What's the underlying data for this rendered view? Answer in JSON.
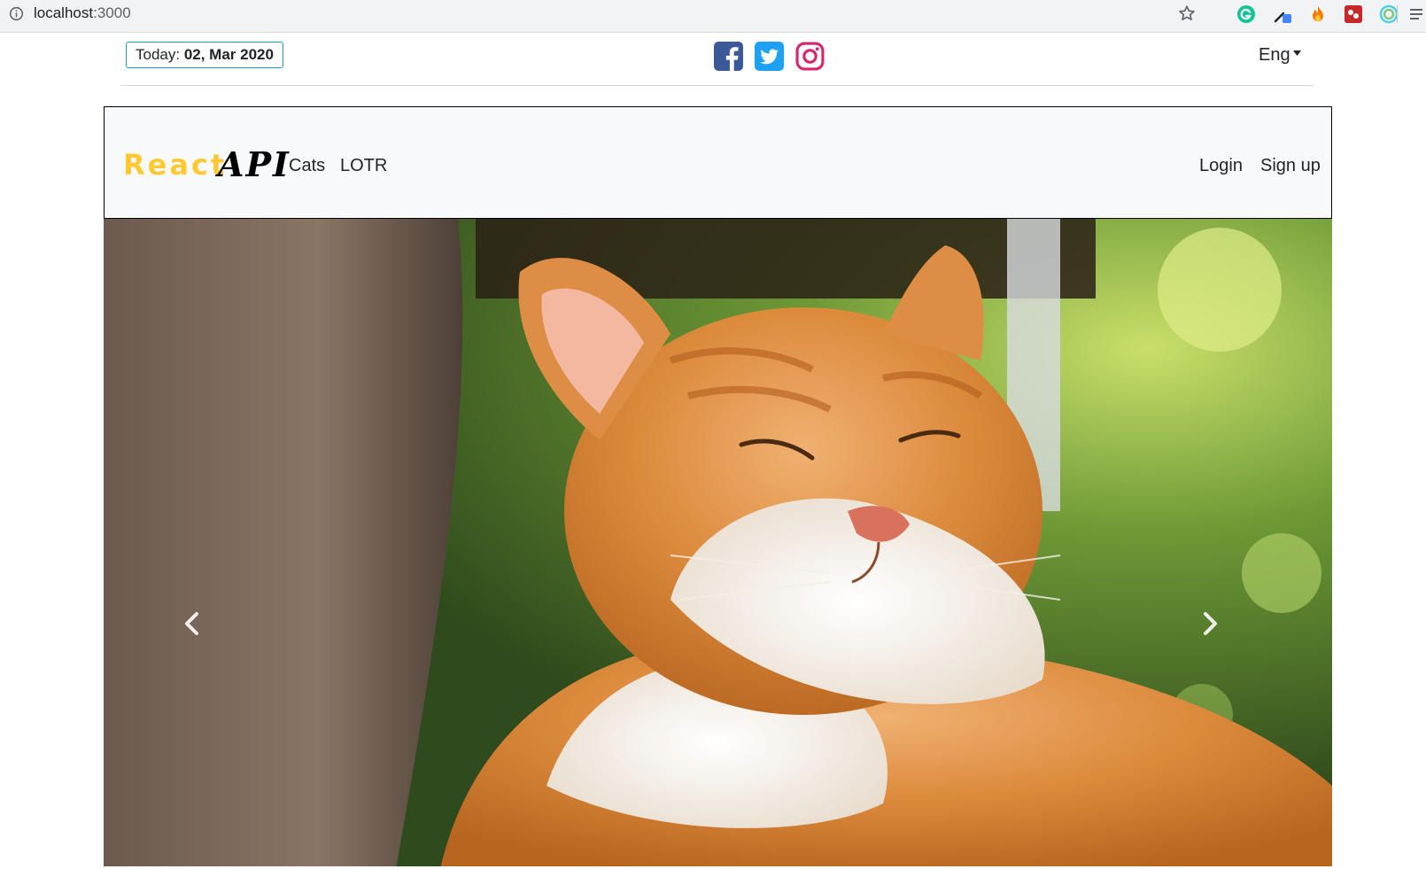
{
  "browser": {
    "url_host": "localhost",
    "url_port": ":3000"
  },
  "topbar": {
    "today_label": "Today:",
    "today_date": "02, Mar 2020",
    "language": "Eng",
    "social_icons": [
      "facebook-icon",
      "twitter-icon",
      "instagram-icon"
    ]
  },
  "navbar": {
    "brand_react": "React",
    "brand_api": "API",
    "links": [
      "Cats",
      "LOTR"
    ],
    "login": "Login",
    "signup": "Sign up"
  },
  "carousel": {
    "prev_icon": "chevron-left-icon",
    "next_icon": "chevron-right-icon"
  },
  "colors": {
    "brand_yellow": "#ffc933",
    "today_border": "#17a2b8",
    "facebook": "#3b5998",
    "twitter": "#1da1f2",
    "instagram": "#e1306c",
    "navbar_bg": "#f8f9fa"
  }
}
